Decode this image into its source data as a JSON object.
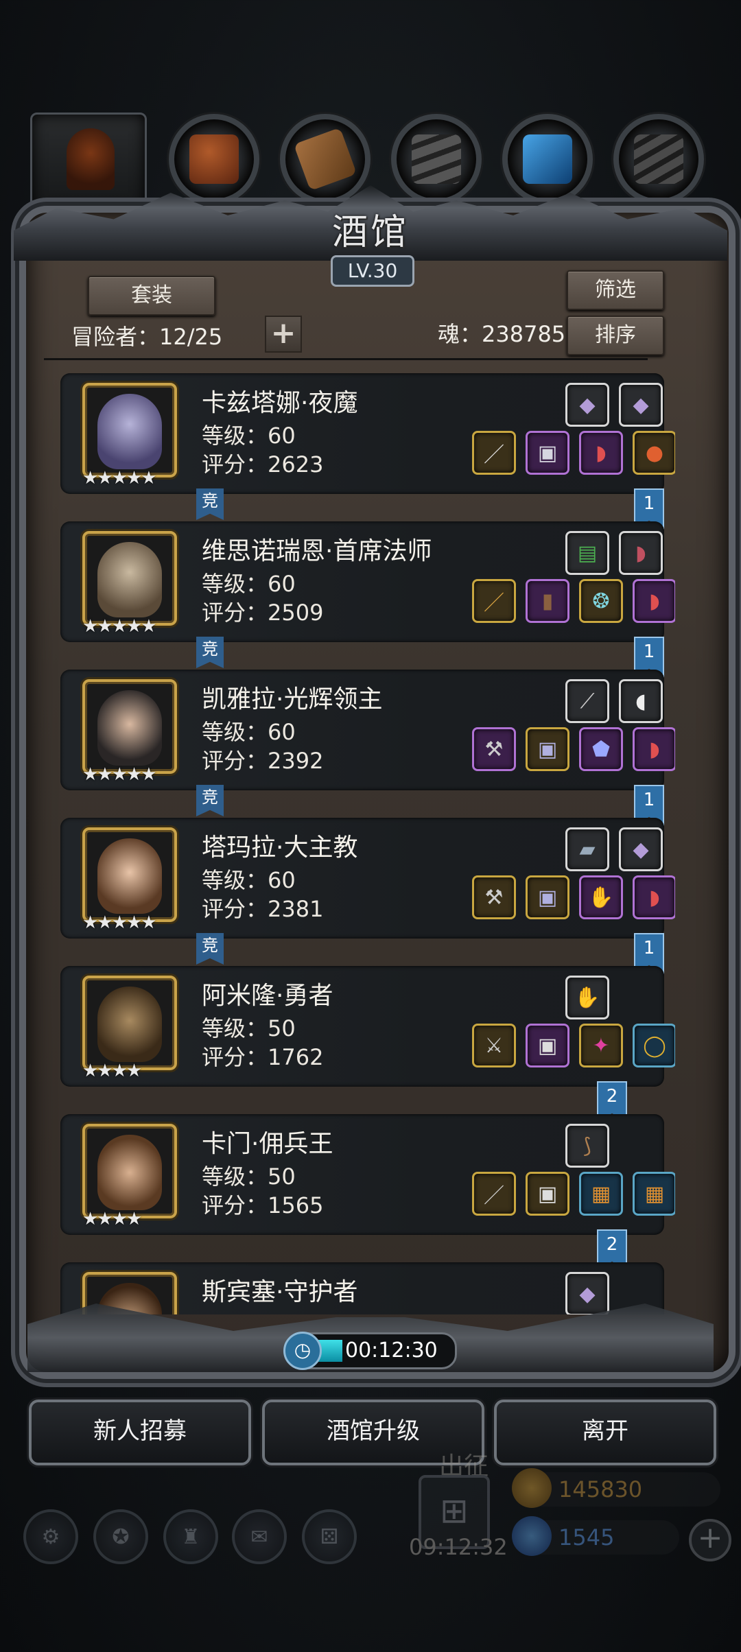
{
  "panel": {
    "title": "酒馆",
    "level": "LV.30",
    "set_button": "套装",
    "filter_button": "筛选",
    "sort_button": "排序",
    "adventurers_label": "冒险者：12/25",
    "soul_label": "魂：238785",
    "add_symbol": "+"
  },
  "heroes": [
    {
      "name": "卡兹塔娜·夜魔",
      "level": "等级：60",
      "score": "评分：2623",
      "stars": "★★★★★",
      "tag": "竞",
      "ribbon": "1"
    },
    {
      "name": "维思诺瑞恩·首席法师",
      "level": "等级：60",
      "score": "评分：2509",
      "stars": "★★★★★",
      "tag": "竞",
      "ribbon": "1"
    },
    {
      "name": "凯雅拉·光辉领主",
      "level": "等级：60",
      "score": "评分：2392",
      "stars": "★★★★★",
      "tag": "竞",
      "ribbon": "1"
    },
    {
      "name": "塔玛拉·大主教",
      "level": "等级：60",
      "score": "评分：2381",
      "stars": "★★★★★",
      "tag": "竞",
      "ribbon": "1"
    },
    {
      "name": "阿米隆·勇者",
      "level": "等级：50",
      "score": "评分：1762",
      "stars": "★★★★",
      "tag": "",
      "ribbon": "2"
    },
    {
      "name": "卡门·佣兵王",
      "level": "等级：50",
      "score": "评分：1565",
      "stars": "★★★★",
      "tag": "",
      "ribbon": "2"
    },
    {
      "name": "斯宾塞·守护者",
      "level": "",
      "score": "",
      "stars": "",
      "tag": "",
      "ribbon": ""
    }
  ],
  "timer": {
    "value": "00:12:30"
  },
  "actions": {
    "recruit": "新人招募",
    "upgrade": "酒馆升级",
    "leave": "离开"
  },
  "background_hud": {
    "expedition_label": "出征",
    "expedition_timer": "09:12:32",
    "gold": "145830",
    "gems": "1545",
    "plus": "+"
  }
}
